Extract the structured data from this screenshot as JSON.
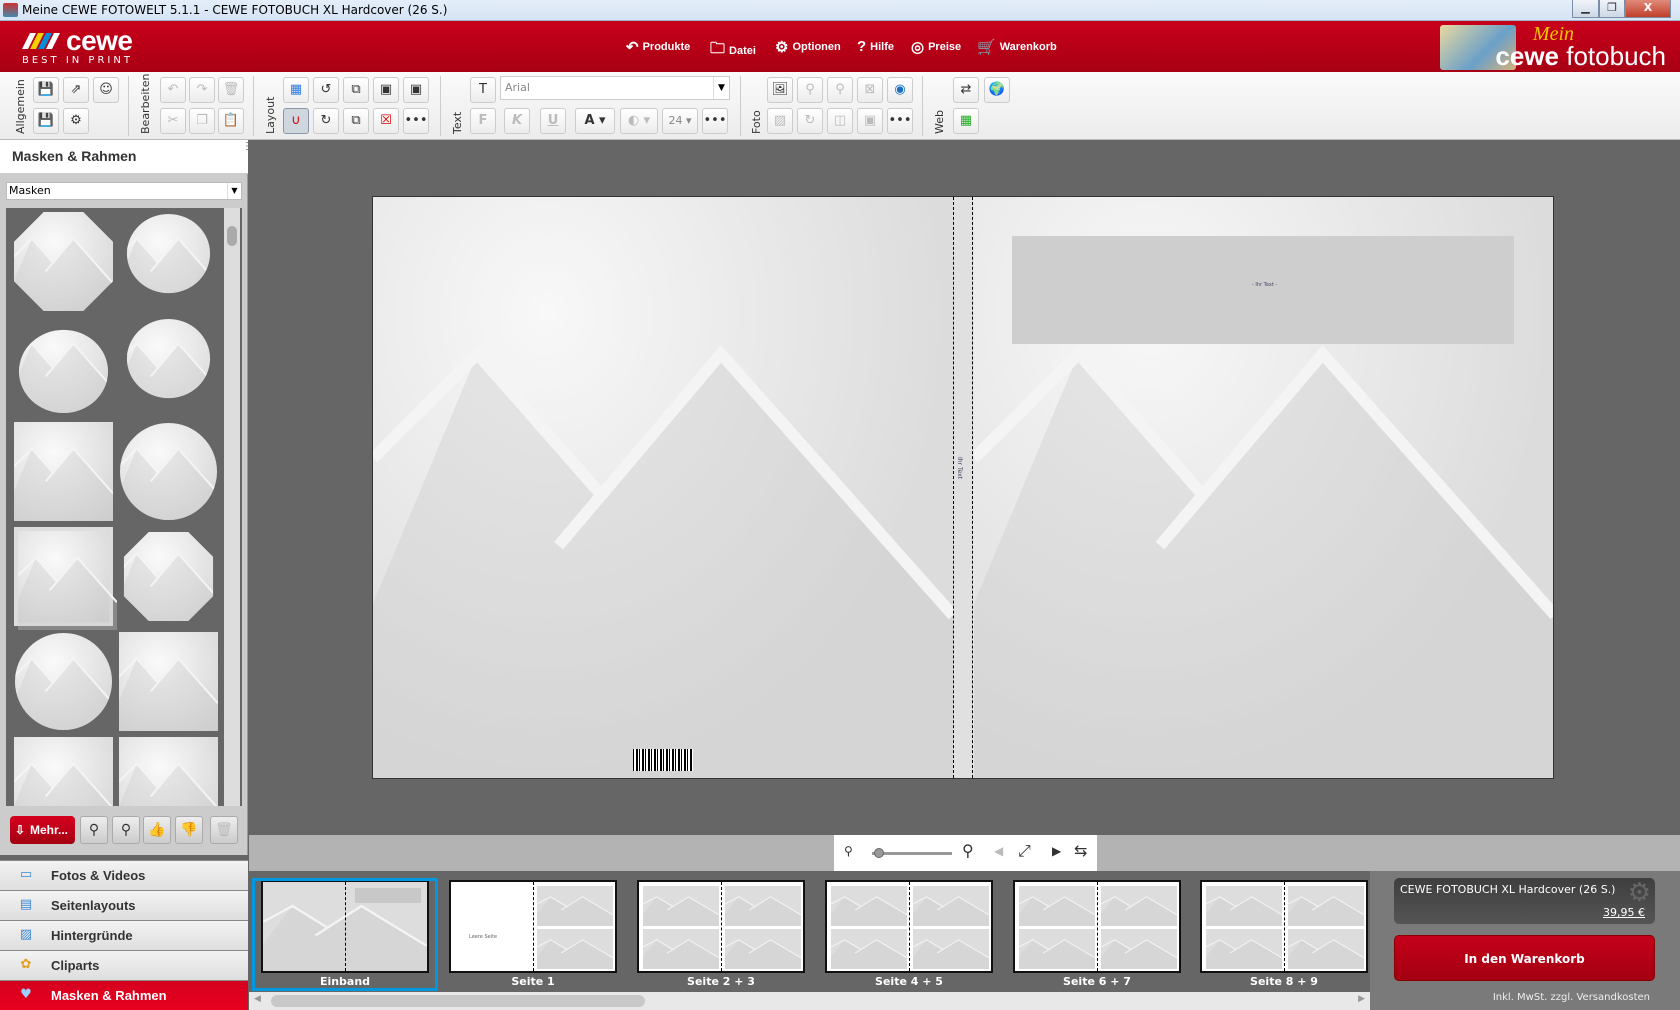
{
  "window": {
    "title": "Meine CEWE FOTOWELT 5.1.1 - CEWE FOTOBUCH XL Hardcover  (26 S.)",
    "controls": [
      "minimize",
      "restore",
      "close"
    ]
  },
  "header": {
    "logo": {
      "name": "cewe",
      "tagline": "BEST IN PRINT"
    },
    "menu": [
      {
        "label": "Produkte",
        "icon": "return-arrow-icon"
      },
      {
        "label": "Datei",
        "icon": "folder-icon"
      },
      {
        "label": "Optionen",
        "icon": "gear-icon"
      },
      {
        "label": "Hilfe",
        "icon": "question-icon"
      },
      {
        "label": "Preise",
        "icon": "coins-icon"
      },
      {
        "label": "Warenkorb",
        "icon": "cart-icon"
      }
    ],
    "brand": {
      "mein": "Mein",
      "cewe": "cewe",
      "fotobuch": "fotobuch"
    }
  },
  "toolbar": {
    "groups": {
      "allgemein": "Allgemein",
      "bearbeiten": "Bearbeiten",
      "layout": "Layout",
      "text": "Text",
      "foto": "Foto",
      "web": "Web"
    },
    "font": "Arial",
    "font_size": "24",
    "bold": "F",
    "italic": "K",
    "underline": "U",
    "color": "A"
  },
  "left_panel": {
    "title": "Masken & Rahmen",
    "dropdown": "Masken",
    "masks": [
      "octagon",
      "balloon",
      "apple",
      "balloon-shaded",
      "landscape-strip",
      "basketball",
      "framed-picture",
      "soft-octagon",
      "baseball",
      "split-panel",
      "rectangle",
      "rectangle-strip"
    ],
    "more_button": "Mehr...",
    "nav": [
      {
        "label": "Fotos & Videos",
        "icon": "photo-icon"
      },
      {
        "label": "Seitenlayouts",
        "icon": "layout-icon"
      },
      {
        "label": "Hintergründe",
        "icon": "background-icon"
      },
      {
        "label": "Cliparts",
        "icon": "flower-icon"
      },
      {
        "label": "Masken & Rahmen",
        "icon": "heart-icon",
        "active": true
      }
    ]
  },
  "canvas": {
    "title_placeholder": "- Ihr Text -",
    "spine_text": "Ihr Text"
  },
  "thumbnails": [
    {
      "label": "Einband",
      "selected": true
    },
    {
      "label": "Seite 1",
      "blank_text": "Leere Seite"
    },
    {
      "label": "Seite 2 + 3"
    },
    {
      "label": "Seite 4 + 5"
    },
    {
      "label": "Seite 6 + 7"
    },
    {
      "label": "Seite 8 + 9"
    }
  ],
  "order": {
    "product": "CEWE FOTOBUCH XL Hardcover  (26 S.)",
    "price": "39,95 €",
    "cart_button": "In den Warenkorb",
    "note": "Inkl. MwSt. zzgl. Versandkosten"
  },
  "colors": {
    "brand_red": "#c8001a",
    "selection_blue": "#0098e0"
  }
}
